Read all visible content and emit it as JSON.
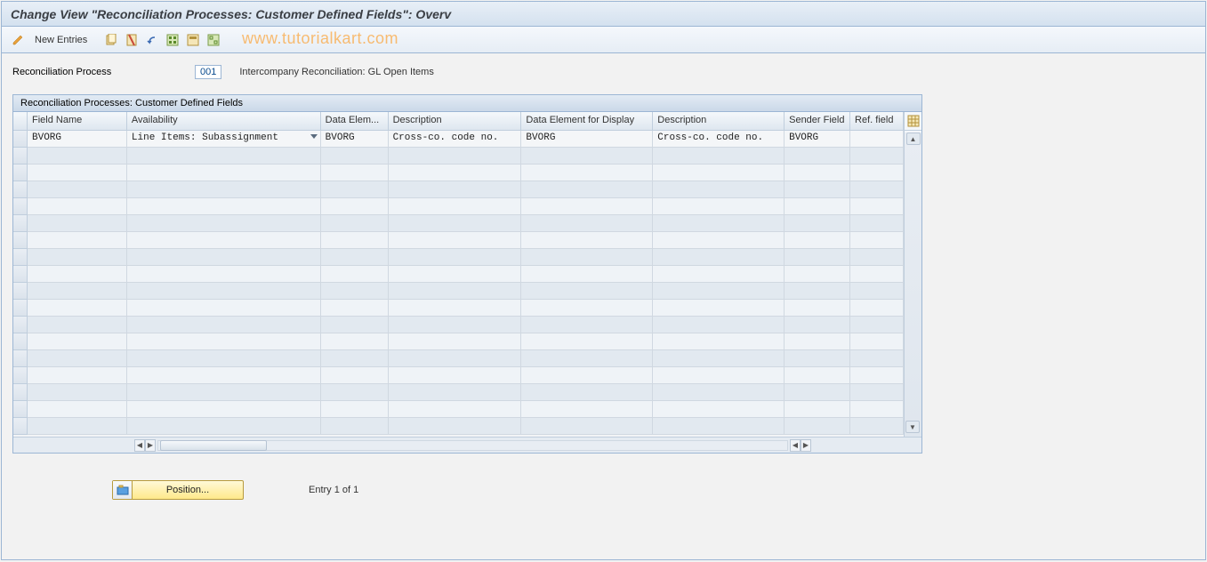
{
  "title": "Change View \"Reconciliation Processes: Customer Defined Fields\": Overv",
  "toolbar": {
    "new_entries_label": "New Entries"
  },
  "watermark": "www.tutorialkart.com",
  "header": {
    "label": "Reconciliation Process",
    "value": "001",
    "desc": "Intercompany Reconciliation: GL Open Items"
  },
  "table": {
    "title": "Reconciliation Processes: Customer Defined Fields",
    "columns": {
      "field_name": "Field Name",
      "availability": "Availability",
      "data_elem": "Data Elem...",
      "desc1": "Description",
      "data_elem_disp": "Data Element for Display",
      "desc2": "Description",
      "sender": "Sender Field",
      "ref": "Ref. field"
    },
    "rows": [
      {
        "field_name": "BVORG",
        "availability": "Line Items: Subassignment",
        "data_elem": "BVORG",
        "desc1": "Cross-co. code no.",
        "data_elem_disp": "BVORG",
        "desc2": "Cross-co. code no.",
        "sender": "BVORG",
        "ref": ""
      }
    ],
    "empty_rows": 17
  },
  "footer": {
    "position_label": "Position...",
    "entry_text": "Entry 1 of 1"
  }
}
